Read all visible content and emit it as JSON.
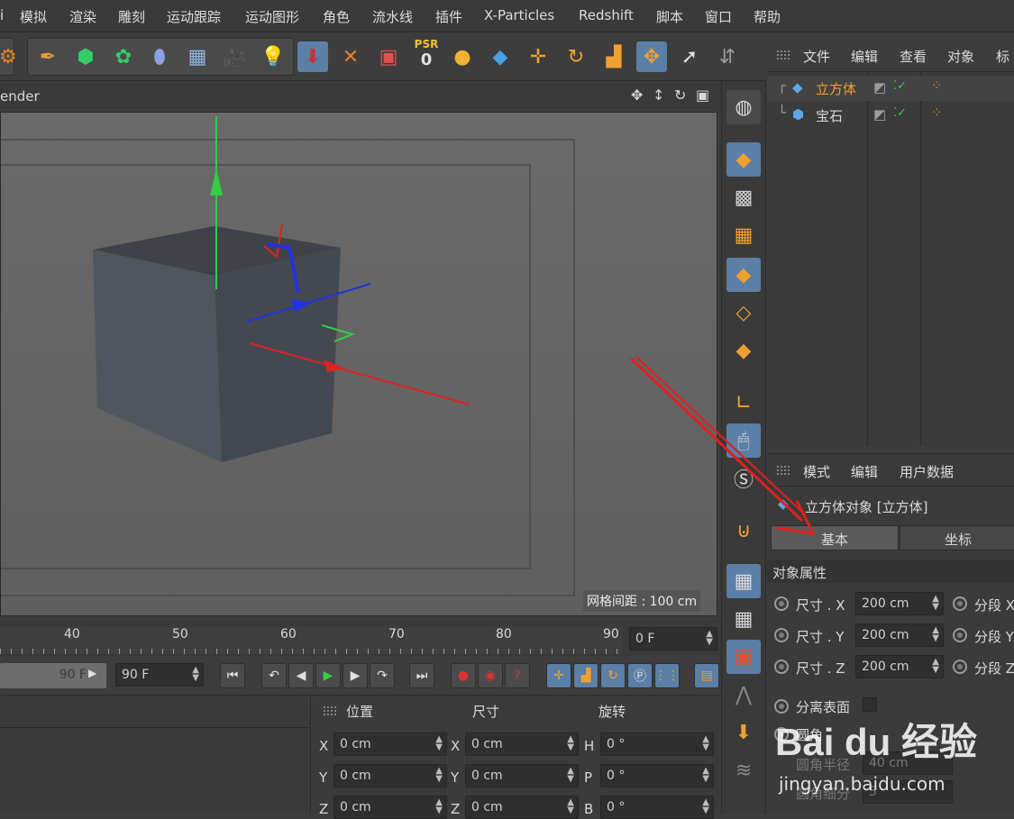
{
  "menu": [
    "模拟",
    "渲染",
    "雕刻",
    "运动跟踪",
    "运动图形",
    "角色",
    "流水线",
    "插件",
    "X-Particles",
    "Redshift",
    "脚本",
    "窗口",
    "帮助"
  ],
  "toolbar": {
    "psr_label": "PSR",
    "psr_value": "0",
    "xyz": "X\nY\nZ"
  },
  "viewport": {
    "title_partial": "ender",
    "grid_spacing": "网格间距 : 100 cm"
  },
  "object_manager": {
    "menu": [
      "文件",
      "编辑",
      "查看",
      "对象",
      "标"
    ],
    "objects": [
      {
        "name": "立方体",
        "selected": true
      },
      {
        "name": "宝石",
        "selected": false
      }
    ]
  },
  "attribute_manager": {
    "menu": [
      "模式",
      "编辑",
      "用户数据"
    ],
    "object_title": "立方体对象 [立方体]",
    "tabs": [
      "基本",
      "坐标"
    ],
    "section": "对象属性",
    "size_fields": [
      {
        "label": "尺寸 . X",
        "value": "200 cm",
        "seg_label": "分段 X"
      },
      {
        "label": "尺寸 . Y",
        "value": "200 cm",
        "seg_label": "分段 Y"
      },
      {
        "label": "尺寸 . Z",
        "value": "200 cm",
        "seg_label": "分段 Z"
      }
    ],
    "separate_surfaces": "分离表面",
    "fillet": "圆角",
    "fillet_radius": "圆角半径",
    "fillet_radius_value": "40 cm",
    "fillet_subdiv": "圆角细分",
    "fillet_subdiv_value": "5"
  },
  "timeline": {
    "ticks": [
      "40",
      "50",
      "60",
      "70",
      "80",
      "90"
    ],
    "current_frame": "0 F",
    "end_frame_slider": "90 F",
    "end_frame": "90 F"
  },
  "coords": {
    "headers": [
      "位置",
      "尺寸",
      "旋转"
    ],
    "rows": [
      {
        "pos_axis": "X",
        "pos": "0 cm",
        "size_axis": "X",
        "size": "0 cm",
        "rot_axis": "H",
        "rot": "0 °"
      },
      {
        "pos_axis": "Y",
        "pos": "0 cm",
        "size_axis": "Y",
        "size": "0 cm",
        "rot_axis": "P",
        "rot": "0 °"
      },
      {
        "pos_axis": "Z",
        "pos": "0 cm",
        "size_axis": "Z",
        "size": "0 cm",
        "rot_axis": "B",
        "rot": "0 °"
      }
    ]
  },
  "watermark": {
    "brand": "Bai du 经验",
    "url": "jingyan.baidu.com"
  },
  "colors": {
    "accent_blue": "#5b7fa6",
    "selected_object": "#f0a030",
    "arrow_red": "#e02020"
  }
}
